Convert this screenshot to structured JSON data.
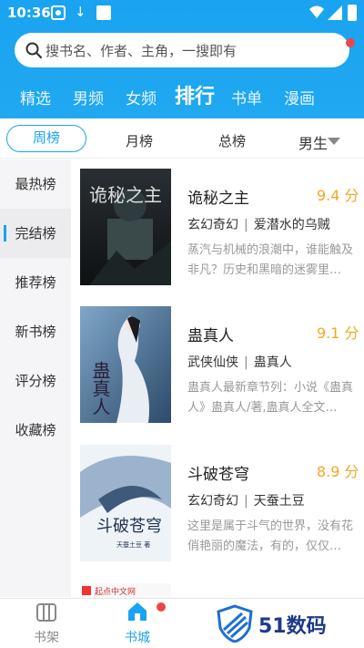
{
  "status_bar": {
    "time": "10:36"
  },
  "search": {
    "placeholder": "搜书名、作者、主角，一搜即有"
  },
  "top_nav": [
    "精选",
    "男频",
    "女频",
    "排行",
    "书单",
    "漫画"
  ],
  "top_nav_active": "排行",
  "filters": {
    "tabs": [
      "周榜",
      "月榜",
      "总榜"
    ],
    "active": "周榜",
    "gender": "男生"
  },
  "sidebar": {
    "items": [
      "最热榜",
      "完结榜",
      "推荐榜",
      "新书榜",
      "评分榜",
      "收藏榜"
    ],
    "active": "完结榜"
  },
  "books": [
    {
      "title": "诡秘之主",
      "score": "9.4 分",
      "genre": "玄幻奇幻",
      "author": "爱潜水的乌贼",
      "desc": "蒸汽与机械的浪潮中，谁能触及非凡？历史和黑暗的迷雾里…",
      "cover_text": "诡秘之主"
    },
    {
      "title": "蛊真人",
      "score": "9.1 分",
      "genre": "武侠仙侠",
      "author": "蛊真人",
      "desc": "蛊真人最新章节列：小说《蛊真人》蛊真人/著,蛊真人全文…",
      "cover_text": "蛊真人"
    },
    {
      "title": "斗破苍穹",
      "score": "8.9 分",
      "genre": "玄幻奇幻",
      "author": "天蚕土豆",
      "desc": "这里是属于斗气的世界，没有花俏艳丽的魔法，有的，仅仅…",
      "cover_text": "斗破苍穹",
      "cover_author": "天蚕土豆 著"
    }
  ],
  "partial_book": {
    "label": "起点中文网"
  },
  "bottom_tabs": [
    {
      "label": "书架",
      "icon": "bookshelf-icon"
    },
    {
      "label": "书城",
      "icon": "bookstore-home-icon"
    }
  ],
  "watermark": {
    "text": "51数码"
  },
  "colors": {
    "accent": "#1aa3f0",
    "score": "#f5a623",
    "badge": "#f0444a"
  }
}
